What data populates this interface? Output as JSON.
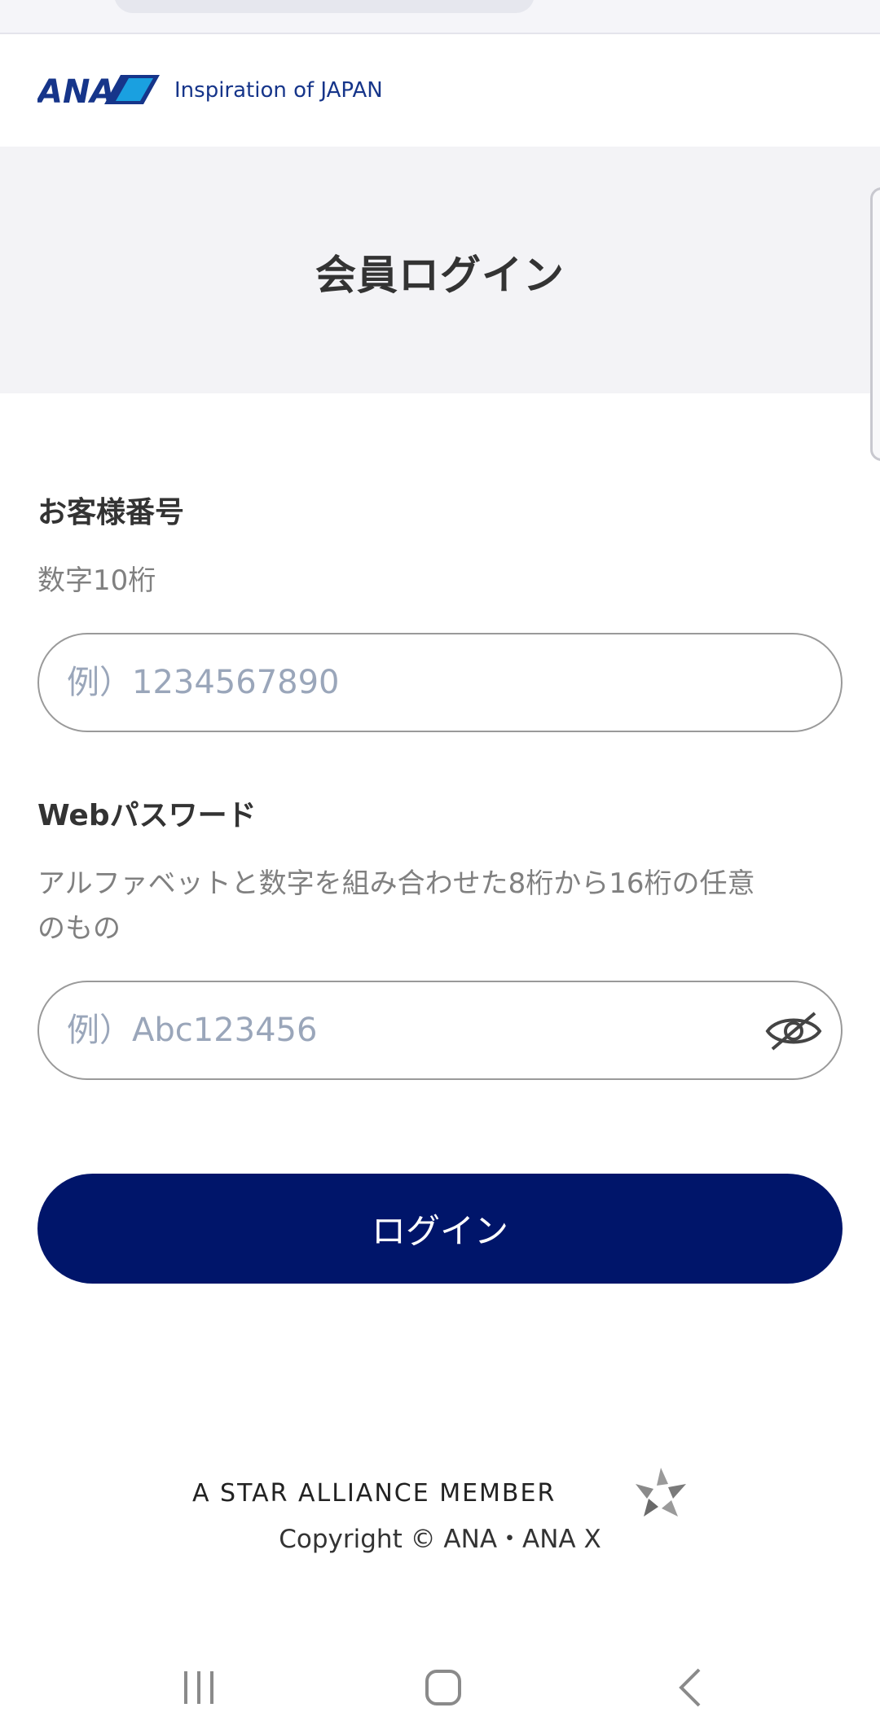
{
  "header": {
    "logo_text": "ANA",
    "tagline": "Inspiration of JAPAN"
  },
  "title": "会員ログイン",
  "customer_number": {
    "label": "お客様番号",
    "hint": "数字10桁",
    "placeholder": "例）1234567890"
  },
  "password": {
    "label": "Webパスワード",
    "hint_line1": "アルファベットと数字を組み合わせた8桁から16桁の任意",
    "hint_line2": "のもの",
    "placeholder": "例）Abc123456"
  },
  "login_button": "ログイン",
  "footer": {
    "alliance": "A STAR ALLIANCE MEMBER",
    "copyright": "Copyright © ANA・ANA X"
  },
  "colors": {
    "brand_navy": "#00156a",
    "logo_blue": "#16358a",
    "placeholder": "#9aa6ba"
  }
}
